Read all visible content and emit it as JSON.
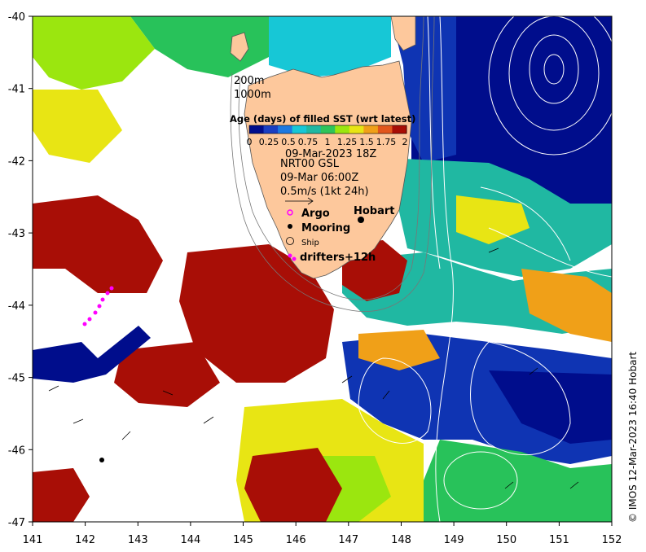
{
  "map": {
    "lon_ticks": [
      "141",
      "142",
      "143",
      "144",
      "145",
      "146",
      "147",
      "148",
      "149",
      "150",
      "151",
      "152"
    ],
    "lat_ticks": [
      "-40",
      "-41",
      "-42",
      "-43",
      "-44",
      "-45",
      "-46",
      "-47"
    ],
    "lon_range": [
      141,
      152
    ],
    "lat_range": [
      -47,
      -40
    ],
    "colors": {
      "land": "#fdc89c",
      "stale": "#a80e06",
      "deep_blue": "#000d8c",
      "blue": "#0f34b3",
      "teal": "#20b8a2",
      "cyan": "#17c7d6",
      "green": "#28c25a",
      "lime": "#9be60f",
      "yellow": "#e8e514",
      "contour": "#ffffff"
    }
  },
  "depth_labels": {
    "d200": "200m",
    "d1000": "1000m"
  },
  "colorbar": {
    "title": "Age (days) of filled SST (wrt latest)",
    "tick_labels": [
      "0",
      "0.25",
      "0.5",
      "0.75",
      "1",
      "1.25",
      "1.5",
      "1.75",
      "2"
    ],
    "colors": [
      "#000d8c",
      "#1a3fc2",
      "#1c79e0",
      "#17c7d6",
      "#20b8a2",
      "#2ec45a",
      "#9be60f",
      "#e8e514",
      "#f0a018",
      "#e2561c",
      "#a80e06"
    ]
  },
  "product": {
    "date": "09-Mar-2023 18Z",
    "name": "NRT00 GSL",
    "current_time": "09-Mar 06:00Z",
    "scale": "0.5m/s (1kt 24h)"
  },
  "legend": {
    "argo": "Argo",
    "mooring": "Mooring",
    "ship": "Ship",
    "drifters": "drifters+12h",
    "hobart": "Hobart"
  },
  "credit": "© IMOS 12-Mar-2023 16:40 Hobart"
}
